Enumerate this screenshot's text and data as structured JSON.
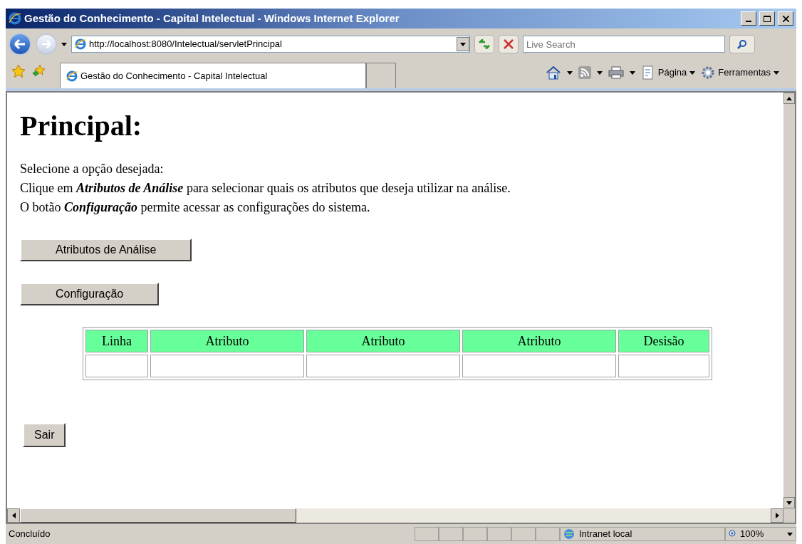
{
  "window": {
    "title": "Gestão do Conhecimento - Capital Intelectual - Windows Internet Explorer"
  },
  "address_bar": {
    "url": "http://localhost:8080/Intelectual/servletPrincipal"
  },
  "search": {
    "placeholder": "Live Search"
  },
  "tabs": [
    {
      "label": "Gestão do Conhecimento - Capital Intelectual",
      "selected": true
    }
  ],
  "command_bar": [
    "Página",
    "Ferramentas"
  ],
  "page": {
    "heading": "Principal:",
    "paragraphs": [
      "Selecione a opção desejada:",
      "Clique em **Atributos de Análise** para selecionar quais os atributos que deseja utilizar na análise.",
      "O botão **Configuração** permite acessar as configurações do sistema."
    ],
    "buttons": [
      "Atributos de Análise",
      "Configuração"
    ],
    "table": {
      "columns": [
        "Linha",
        "Atributo",
        "Atributo",
        "Atributo",
        "Desisão"
      ]
    },
    "exit_button": "Sair"
  },
  "status_bar": {
    "text": "Concluído",
    "zone": "Intranet local",
    "zoom": "100%"
  }
}
